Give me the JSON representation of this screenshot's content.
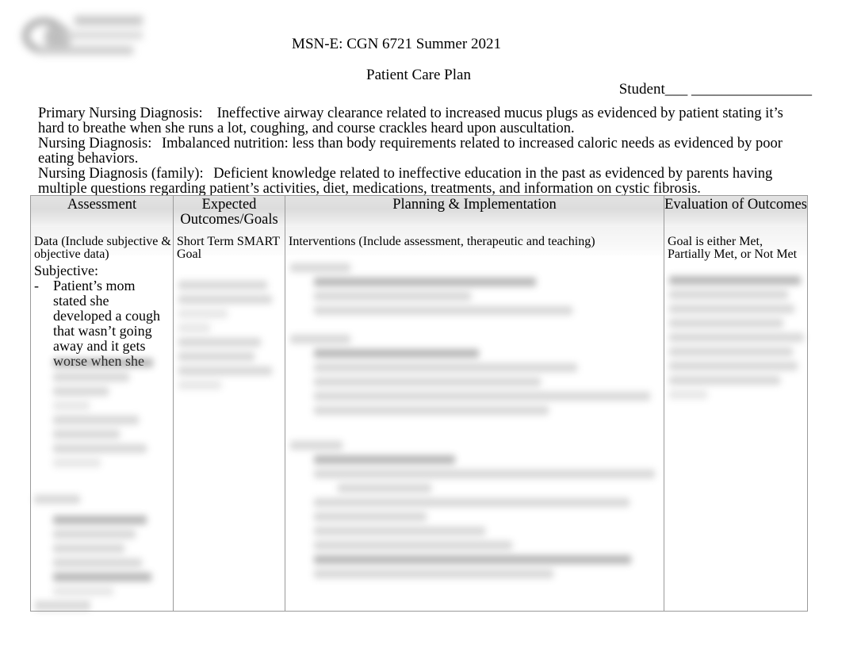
{
  "document": {
    "type": "Patient Care Plan worksheet",
    "course_line": "MSN-E: CGN 6721 Summer 2021",
    "title": "Patient Care Plan",
    "student_line": "Student___ ________________",
    "logo_alt": "university-logo (redacted)"
  },
  "diagnoses": {
    "primary_label": "Primary Nursing Diagnosis:",
    "primary_text": "Ineffective airway clearance related to increased mucus plugs as evidenced by patient stating it’s hard to breathe when she runs a lot, coughing, and course crackles heard upon auscultation.",
    "secondary_label": "Nursing Diagnosis:",
    "secondary_text": "Imbalanced nutrition: less than body requirements related to increased caloric needs as evidenced by poor eating behaviors.",
    "family_label": "Nursing Diagnosis (family):",
    "family_text": "Deficient knowledge related to ineffective education in the past as evidenced by parents having multiple questions regarding patient’s activities, diet, medications, treatments, and information on cystic fibrosis."
  },
  "table": {
    "columns": [
      {
        "title": "Assessment",
        "subtitle": "Data (Include subjective & objective data)"
      },
      {
        "title": "Expected Outcomes/Goals",
        "subtitle": "Short Term SMART Goal"
      },
      {
        "title": "Planning & Implementation",
        "subtitle": "Interventions (Include assessment, therapeutic and teaching)"
      },
      {
        "title": "Evaluation of Outcomes",
        "subtitle": "Goal is either Met, Partially Met, or Not Met"
      }
    ],
    "body": {
      "assessment": {
        "subjective_heading": "Subjective:",
        "bullet_dash": "-",
        "bullet_text": "Patient’s mom stated she developed a cough that wasn’t going away and it gets worse when she",
        "redacted_note": "remaining assessment content is blurred / illegible"
      },
      "expected_outcomes": {
        "redacted_note": "content is blurred / illegible"
      },
      "planning": {
        "redacted_note": "content is blurred / illegible"
      },
      "evaluation": {
        "redacted_note": "content is blurred / illegible"
      }
    }
  },
  "footer": {
    "redacted_note": "blurred footer text"
  }
}
